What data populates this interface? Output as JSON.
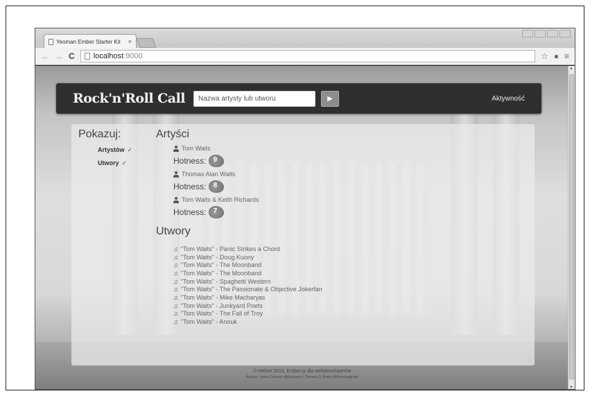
{
  "browser": {
    "tab_title": "Yeoman Ember Starter Kit",
    "tab_close": "×",
    "url_host": "localhost",
    "url_port": ":9000",
    "back": "←",
    "forward": "→",
    "reload": "C",
    "star": "☆",
    "menu": "≡"
  },
  "navbar": {
    "brand": "Rock'n'Roll Call",
    "search_placeholder": "Nazwa artysty lub utworu",
    "go_label": "▶",
    "activity": "Aktywność"
  },
  "sidebar": {
    "heading": "Pokazuj:",
    "filters": [
      {
        "label": "Artystów",
        "check": "✓"
      },
      {
        "label": "Utwory",
        "check": "✓"
      }
    ]
  },
  "artists": {
    "heading": "Artyści",
    "hotness_label": "Hotness:",
    "items": [
      {
        "name": "Tom Waits",
        "hotness": "9"
      },
      {
        "name": "Thomas Alan Waits",
        "hotness": "8"
      },
      {
        "name": "Tom Waits & Keith Richards",
        "hotness": "7"
      }
    ]
  },
  "tracks": {
    "heading": "Utwory",
    "items": [
      "\"Tom Waits\" - Panic Strikes a Chord",
      "\"Tom Waits\" - Doug Kuony",
      "\"Tom Waits\" - The Moonband",
      "\"Tom Waits\" - The Moonband",
      "\"Tom Waits\" - Spaghetti Western",
      "\"Tom Waits\" - The Passionate & Objective Jokerfan",
      "\"Tom Waits\" - Mike Macharyas",
      "\"Tom Waits\" - Junkyard Poets",
      "\"Tom Waits\" - The Fall of Troy",
      "\"Tom Waits\" - Anouk"
    ]
  },
  "footer": {
    "copyright": "© Helion 2015, Ember.js dla webdeveloperów",
    "authors": "Autorzy: Jesse Cravens @jdcravens i Thomas Q. Brady @thomasqbrady"
  }
}
